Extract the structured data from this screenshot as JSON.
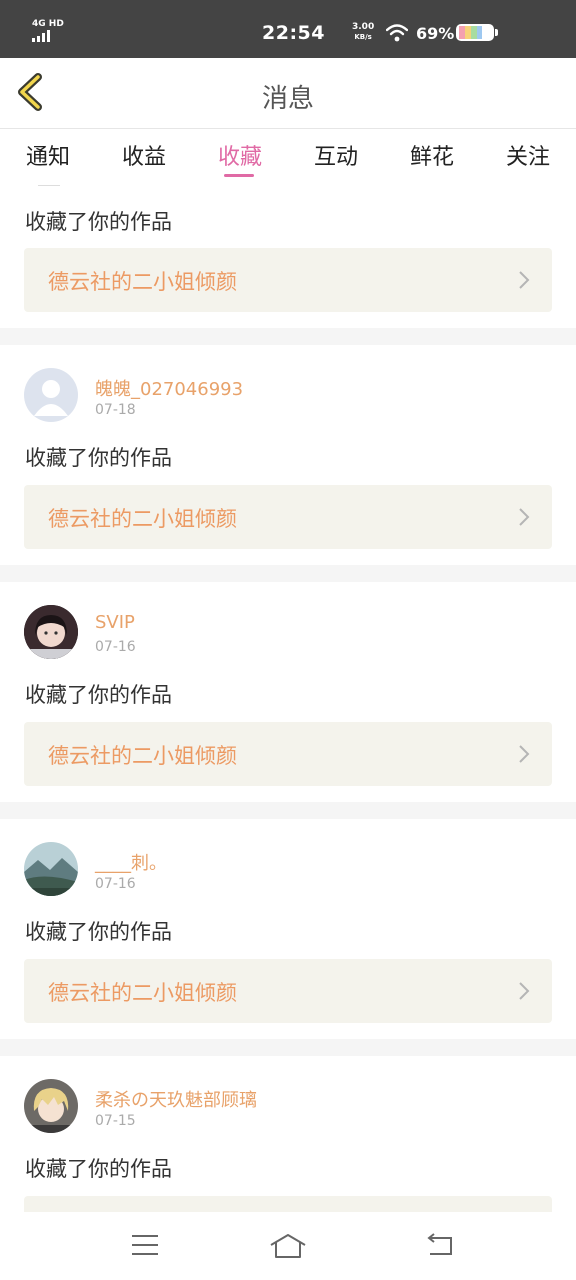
{
  "status_bar": {
    "network": "4G HD",
    "time": "22:54",
    "speed_value": "3.00",
    "speed_unit": "KB/s",
    "battery": "69%"
  },
  "header": {
    "title": "消息",
    "back_icon": "chevron-left-icon"
  },
  "tabs": [
    {
      "label": "通知"
    },
    {
      "label": "收益"
    },
    {
      "label": "收藏",
      "active": true
    },
    {
      "label": "互动"
    },
    {
      "label": "鲜花"
    },
    {
      "label": "关注"
    }
  ],
  "feed": {
    "partial_item": {
      "action": "收藏了你的作品",
      "link": "德云社的二小姐倾颜"
    },
    "items": [
      {
        "username": "魄魄_027046993",
        "date": "07-18",
        "action": "收藏了你的作品",
        "link": "德云社的二小姐倾颜",
        "avatar": "default-avatar"
      },
      {
        "username": "SVIP",
        "date": "07-16",
        "action": "收藏了你的作品",
        "link": "德云社的二小姐倾颜",
        "avatar": "girl-photo-avatar"
      },
      {
        "username": "____刺。",
        "date": "07-16",
        "action": "收藏了你的作品",
        "link": "德云社的二小姐倾颜",
        "avatar": "landscape-avatar"
      },
      {
        "username": "柔杀の天玖魅部顾璃",
        "date": "07-15",
        "action": "收藏了你的作品",
        "link": "",
        "avatar": "anime-avatar"
      }
    ]
  },
  "colors": {
    "accent": "#e06aa5",
    "link_text": "#ec9a63",
    "username": "#e8a26a"
  },
  "navbar": {
    "icons": [
      "menu-icon",
      "home-icon",
      "back-icon"
    ]
  }
}
